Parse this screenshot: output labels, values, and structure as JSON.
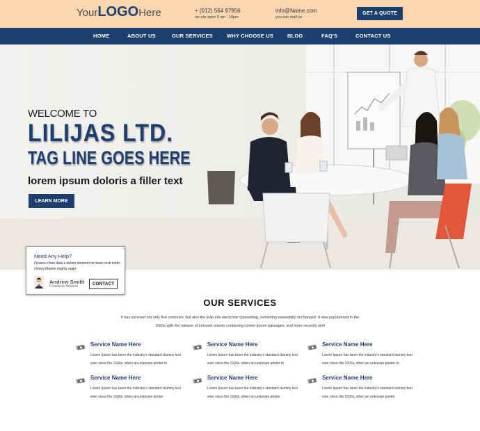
{
  "header": {
    "logo": {
      "prefix": "Your",
      "mid": "LOGO",
      "suffix": "Here"
    },
    "phone": {
      "main": "+ (012) 564 97956",
      "sub": "we are open 9 am - 10pm"
    },
    "email": {
      "main": "info@Name.com",
      "sub": "you can mail us"
    },
    "quote_button": "GET A QUOTE"
  },
  "nav": {
    "items": [
      {
        "label": "HOME"
      },
      {
        "label": "ABOUT US"
      },
      {
        "label": "OUR SERVICES"
      },
      {
        "label": "WHY CHOOSE US"
      },
      {
        "label": "BLOG"
      },
      {
        "label": "FAQ'S"
      },
      {
        "label": "CONTACT US"
      }
    ]
  },
  "hero": {
    "welcome": "WELCOME TO",
    "company": "LILIJAS LTD.",
    "tagline": "TAG LINE GOES HERE",
    "filler": "lorem ipsum doloris a filler text",
    "cta": "LEARN MORE"
  },
  "help_card": {
    "title": "Need Any Help?",
    "text": "Financo chee data k dumm dummm mr bean rock tomb chotoy bheem mighty raaju",
    "name": "Andrew Smith",
    "role": "Financial Advisor",
    "button": "CONTACT"
  },
  "services": {
    "heading": "OUR SERVICES",
    "intro": "It has survived not only five centuries, but also the leap into electronic typesetting, remaining essentially unchanged. It was popularised in the 1960s with the release of Letraset sheets containing Lorem Ipsum passages, and more recently with",
    "items": [
      {
        "name": "Service Name Here",
        "desc": "Lorem Ipsum has been the industry's standard dummy text ever since the 1500s, when an unknown printer to"
      },
      {
        "name": "Service Name Here",
        "desc": "Lorem Ipsum has been the industry's standard dummy text ever since the 1500s, when an unknown printer to"
      },
      {
        "name": "Service Name Here",
        "desc": "Lorem Ipsum has been the industry's standard dummy text ever since the 1500s, when an unknown printer to"
      },
      {
        "name": "Service Name Here",
        "desc": "Lorem Ipsum has been the industry's standard dummy text ever since the 1500s, when an unknown printer"
      },
      {
        "name": "Service Name Here",
        "desc": "Lorem Ipsum has been the industry's standard dummy text ever since the 1500s, when an unknown printer"
      },
      {
        "name": "Service Name Here",
        "desc": "Lorem Ipsum has been the industry's standard dummy text ever since the 1500s, when an unknown printer"
      }
    ],
    "icon": "money-icon"
  },
  "colors": {
    "brand": "#1d3f6e",
    "topbar": "#fbd6b0"
  }
}
